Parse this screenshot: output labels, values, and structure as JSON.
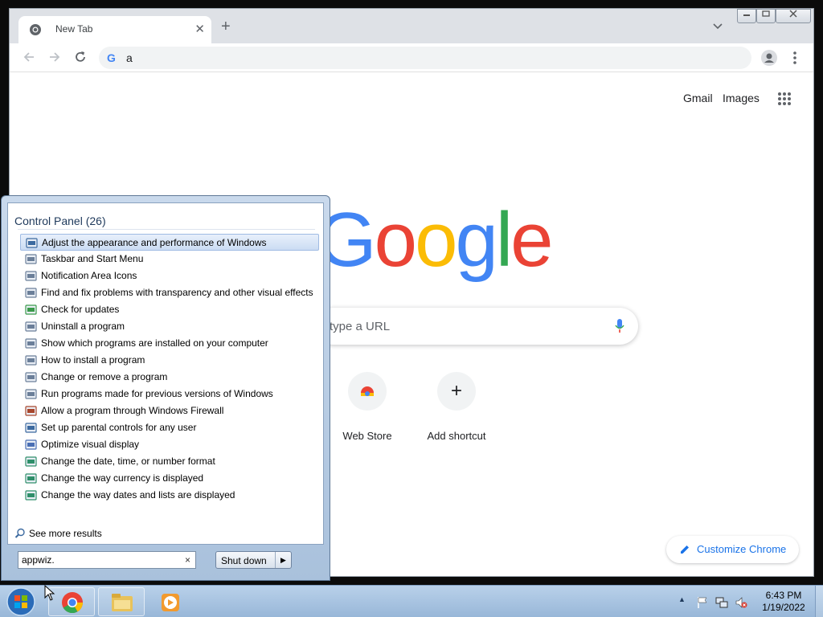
{
  "browser": {
    "tab_title": "New Tab",
    "tab_close": "✕",
    "new_tab": "+",
    "omnibox_value": "a",
    "omnibox_icon": "G",
    "window_controls": [
      "minimize-icon",
      "restore-icon",
      "close-icon"
    ]
  },
  "newtab_page": {
    "links": {
      "gmail": "Gmail",
      "images": "Images"
    },
    "logo_letters": [
      "G",
      "o",
      "o",
      "g",
      "l",
      "e"
    ],
    "logo_colors": [
      "#4285f4",
      "#ea4335",
      "#fbbc05",
      "#4285f4",
      "#34a853",
      "#ea4335"
    ],
    "search_placeholder": "type a URL",
    "shortcuts": [
      {
        "label": "Web Store",
        "icon": "web-store-icon"
      },
      {
        "label": "Add shortcut",
        "icon": "plus-icon",
        "symbol": "+"
      }
    ],
    "customize_label": "Customize Chrome"
  },
  "start_menu": {
    "section_header": "Control Panel (26)",
    "results": [
      "Adjust the appearance and performance of Windows",
      "Taskbar and Start Menu",
      "Notification Area Icons",
      "Find and fix problems with transparency and other visual effects",
      "Check for updates",
      "Uninstall a program",
      "Show which programs are installed on your computer",
      "How to install a program",
      "Change or remove a program",
      "Run programs made for previous versions of Windows",
      "Allow a program through Windows Firewall",
      "Set up parental controls for any user",
      "Optimize visual display",
      "Change the date, time, or number format",
      "Change the way currency is displayed",
      "Change the way dates and lists are displayed"
    ],
    "see_more": "See more results",
    "search_value": "appwiz.",
    "search_clear": "×",
    "shutdown_label": "Shut down",
    "shutdown_arrow": "▶"
  },
  "taskbar": {
    "items": [
      "chrome-icon",
      "file-explorer-icon",
      "media-player-icon"
    ],
    "tray_arrow": "▲",
    "time": "6:43 PM",
    "date": "1/19/2022"
  },
  "colors": {
    "chrome_accent": "#1a73e8",
    "taskbar": "#b9d1ea",
    "selection": "#cbdcf3"
  }
}
